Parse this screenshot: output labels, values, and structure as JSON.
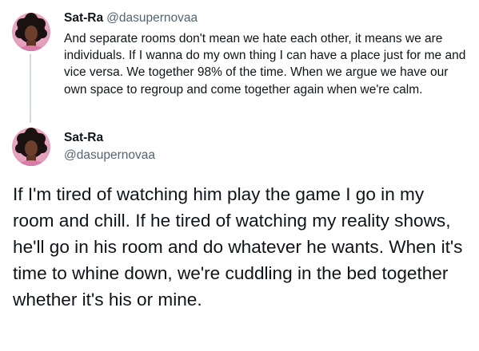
{
  "tweet_1": {
    "author_name": "Sat-Ra",
    "author_handle": "@dasupernovaa",
    "avatar_icon": "profile-photo-avatar",
    "text": "And separate rooms don't mean we hate each other, it means we are individuals. If I wanna do my own thing I can have a place just for me and vice versa. We together 98% of the time. When we argue we have our own space to regroup and come together again when we're calm."
  },
  "tweet_2": {
    "author_name": "Sat-Ra",
    "author_handle": "@dasupernovaa",
    "avatar_icon": "profile-photo-avatar",
    "text": "If I'm tired of watching him play the game I go in my room and chill. If he tired of watching my reality shows, he'll go in his room and do whatever he wants. When it's time to whine down, we're cuddling in the bed together whether it's his or mine."
  },
  "colors": {
    "text_primary": "#0f1419",
    "text_secondary": "#536471",
    "thread_line": "#cfd9de",
    "avatar_bg": "#e7a3bf"
  }
}
